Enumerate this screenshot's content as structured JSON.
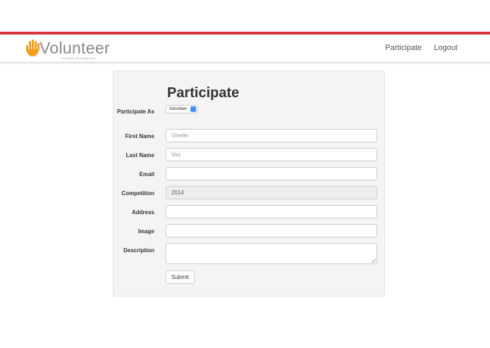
{
  "colors": {
    "accent_bar": "#d9323a",
    "brand_hand": "#f0a020"
  },
  "brand": {
    "name": "Volunteer",
    "tagline": "Your skills can change lives",
    "icon": "hand-icon"
  },
  "nav": {
    "links": [
      "Participate",
      "Logout"
    ]
  },
  "form": {
    "title": "Participate",
    "participate_as": {
      "label": "Participate As",
      "selected": "Volunteer"
    },
    "fields": [
      {
        "label": "First Name",
        "value": "Vinelle",
        "placeholder": "",
        "disabled": false
      },
      {
        "label": "Last Name",
        "value": "Vaz",
        "placeholder": "",
        "disabled": false
      },
      {
        "label": "Email",
        "value": "",
        "placeholder": "",
        "disabled": false
      },
      {
        "label": "Competition",
        "value": "2014",
        "placeholder": "",
        "disabled": true
      },
      {
        "label": "Address",
        "value": "",
        "placeholder": "",
        "disabled": false
      },
      {
        "label": "Image",
        "value": "",
        "placeholder": "",
        "disabled": false
      },
      {
        "label": "Description",
        "value": "",
        "placeholder": "",
        "disabled": false
      }
    ],
    "submit_label": "Submit"
  }
}
